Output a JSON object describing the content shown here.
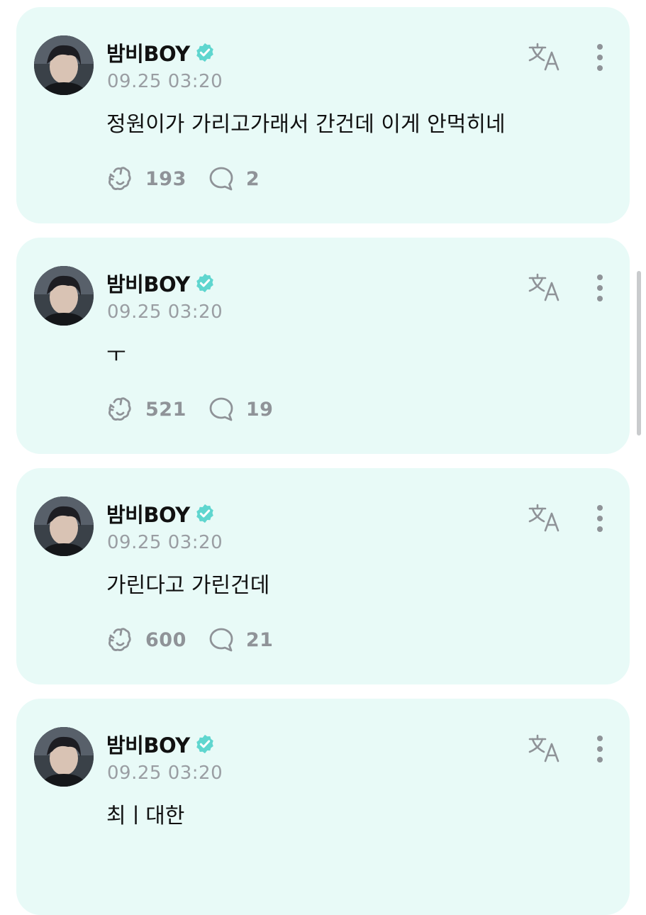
{
  "posts": [
    {
      "author": "밤비BOY",
      "time": "09.25 03:20",
      "text": "정원이가 가리고가래서 간건데 이게 안먹히네",
      "likes": "193",
      "comments": "2"
    },
    {
      "author": "밤비BOY",
      "time": "09.25 03:20",
      "text": "ㅜ",
      "likes": "521",
      "comments": "19"
    },
    {
      "author": "밤비BOY",
      "time": "09.25 03:20",
      "text": "가린다고 가린건데",
      "likes": "600",
      "comments": "21"
    },
    {
      "author": "밤비BOY",
      "time": "09.25 03:20",
      "text": "최ㅣ대한",
      "likes": "",
      "comments": ""
    }
  ],
  "icons": {
    "verified": "verified-badge-icon",
    "translate": "translate-icon",
    "more": "more-options-icon",
    "like": "like-icon",
    "comment": "comment-icon"
  },
  "colors": {
    "card_background": "#e8faf7",
    "verified": "#5fd6cf",
    "meta_text": "#9a9ea3",
    "icon": "#8f9398"
  }
}
